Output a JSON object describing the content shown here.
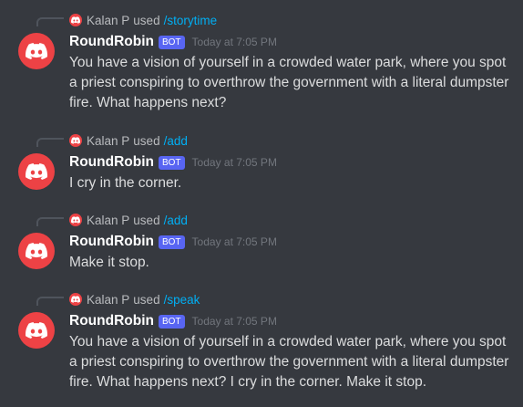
{
  "colors": {
    "background": "#36393f",
    "avatar": "#ed4245",
    "command": "#00aff4",
    "bot_tag": "#5865f2"
  },
  "messages": [
    {
      "invoker": "Kalan P",
      "used": "used",
      "command": "/storytime",
      "author": "RoundRobin",
      "bot_tag": "BOT",
      "timestamp": "Today at 7:05 PM",
      "content": "You have a vision of yourself in a crowded water park, where you spot a priest conspiring to overthrow the government with a literal dumpster fire. What happens next?",
      "avatar_icon": "discord-logo-icon"
    },
    {
      "invoker": "Kalan P",
      "used": "used",
      "command": "/add",
      "author": "RoundRobin",
      "bot_tag": "BOT",
      "timestamp": "Today at 7:05 PM",
      "content": "I cry in the corner.",
      "avatar_icon": "discord-logo-icon"
    },
    {
      "invoker": "Kalan P",
      "used": "used",
      "command": "/add",
      "author": "RoundRobin",
      "bot_tag": "BOT",
      "timestamp": "Today at 7:05 PM",
      "content": "Make it stop.",
      "avatar_icon": "discord-logo-icon"
    },
    {
      "invoker": "Kalan P",
      "used": "used",
      "command": "/speak",
      "author": "RoundRobin",
      "bot_tag": "BOT",
      "timestamp": "Today at 7:05 PM",
      "content": "You have a vision of yourself in a crowded water park, where you spot a priest conspiring to overthrow the government with a literal dumpster fire. What happens next? I cry in the corner. Make it stop.",
      "avatar_icon": "discord-logo-icon"
    }
  ]
}
